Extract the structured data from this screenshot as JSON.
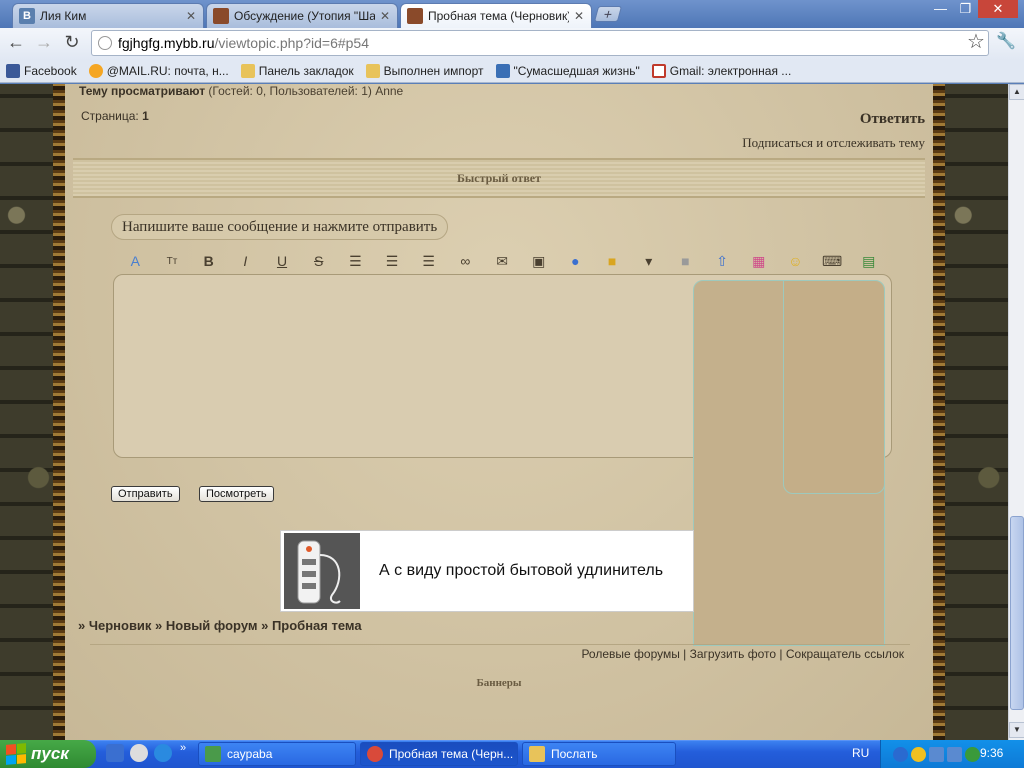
{
  "browser": {
    "tabs": [
      {
        "label": "Лия Ким",
        "icon": "vk-icon",
        "color": "#5a7fae"
      },
      {
        "label": "Обсуждение (Утопия \"Шанс",
        "icon": "forum-avatar-icon",
        "color": "#8a4a2a"
      },
      {
        "label": "Пробная тема (Черновик)",
        "icon": "forum-avatar-icon",
        "color": "#8a4a2a"
      }
    ],
    "new_tab": "+",
    "window_controls": {
      "minimize": "—",
      "restore": "❐",
      "close": "✕"
    },
    "nav": {
      "back": "←",
      "forward": "→",
      "reload": "↻"
    },
    "url_host": "fgjhgfg.mybb.ru",
    "url_path": "/viewtopic.php?id=6#p54",
    "star": "☆",
    "wrench": "🔧",
    "bookmarks": [
      {
        "label": "Facebook",
        "color": "#3b5998"
      },
      {
        "label": "@MAIL.RU: почта, н...",
        "color": "#f5a623"
      },
      {
        "label": "Панель закладок",
        "color": "#e8c35a"
      },
      {
        "label": "Выполнен импорт",
        "color": "#e8c35a"
      },
      {
        "label": "\"Сумасшедшая жизнь\"",
        "color": "#3a6fb5"
      },
      {
        "label": "Gmail: электронная ...",
        "color": "#c0392b"
      }
    ]
  },
  "forum": {
    "viewing_label": "Тему просматривают",
    "viewing_rest": " (Гостей: 0, Пользователей: 1) Anne",
    "page_label": "Страница: ",
    "page_number": "1",
    "reply": "Ответить",
    "subscribe": "Подписаться и отслеживать тему",
    "quick_reply": "Быстрый ответ",
    "message_hint": "Напишите ваше сообщение и нажмите отправить",
    "editor_buttons": [
      {
        "name": "font-color-icon",
        "glyph": "A",
        "color": "#4a7fd0"
      },
      {
        "name": "font-size-icon",
        "glyph": "Tт"
      },
      {
        "name": "bold-icon",
        "glyph": "B"
      },
      {
        "name": "italic-icon",
        "glyph": "I"
      },
      {
        "name": "underline-icon",
        "glyph": "U"
      },
      {
        "name": "strikethrough-icon",
        "glyph": "S"
      },
      {
        "name": "align-left-icon",
        "glyph": "☰"
      },
      {
        "name": "align-center-icon",
        "glyph": "☰"
      },
      {
        "name": "align-right-icon",
        "glyph": "☰"
      },
      {
        "name": "link-icon",
        "glyph": "∞"
      },
      {
        "name": "email-icon",
        "glyph": "✉"
      },
      {
        "name": "image-icon",
        "glyph": "▣"
      },
      {
        "name": "video-icon",
        "glyph": "●",
        "color": "#3a6fd0"
      },
      {
        "name": "hide-icon",
        "glyph": "■",
        "color": "#d9a520"
      },
      {
        "name": "quote-icon",
        "glyph": "▾"
      },
      {
        "name": "table-icon",
        "glyph": "■",
        "color": "#9a9a9a"
      },
      {
        "name": "upload-icon",
        "glyph": "⇧",
        "color": "#3a6fd0"
      },
      {
        "name": "palette-icon",
        "glyph": "▦",
        "color": "#d04a8a"
      },
      {
        "name": "smiley-icon",
        "glyph": "☺",
        "color": "#e0b020"
      },
      {
        "name": "keyboard-icon",
        "glyph": "⌨"
      },
      {
        "name": "attach-icon",
        "glyph": "▤",
        "color": "#3a8a3a"
      }
    ],
    "send": "Отправить",
    "preview": "Посмотреть",
    "ad_text": "А с виду простой бытовой удлинитель",
    "breadcrumbs": "» Черновик » Новый форум » Пробная тема",
    "footer_links": "Ролевые форумы | Загрузить фото | Сокращатель ссылок",
    "banners": "Баннеры"
  },
  "taskbar": {
    "start": "пуск",
    "quicklaunch_more": "»",
    "tasks": [
      {
        "label": "caypaba",
        "color": "#4a9a4a",
        "active": false
      },
      {
        "label": "Пробная тема (Черн...",
        "color": "#d94a3a",
        "active": true
      },
      {
        "label": "Послать",
        "color": "#e8c35a",
        "active": false
      }
    ],
    "language": "RU",
    "clock": "9:36"
  },
  "colors": {
    "accent": "#3a3226",
    "content_bg": "#d4c6a6"
  }
}
